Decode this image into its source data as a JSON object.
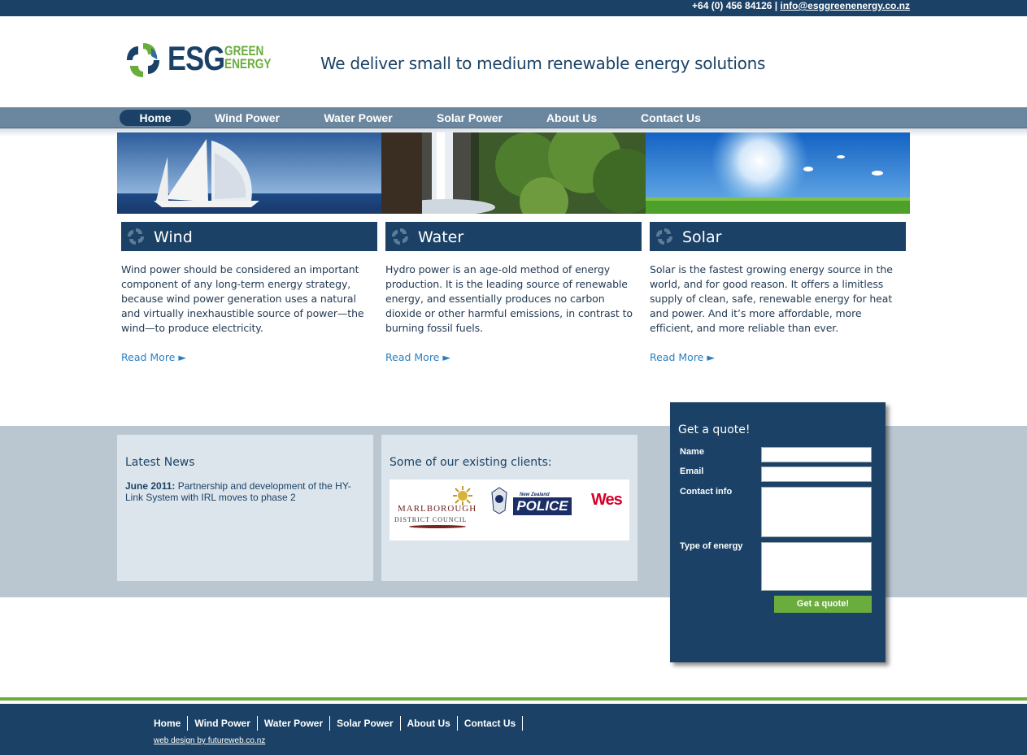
{
  "topbar": {
    "phone": "+64 (0) 456 84126",
    "separator": "|",
    "email": "info@esggreenenergy.co.nz"
  },
  "header": {
    "logo_main": "ESG",
    "logo_sub1": "GREEN",
    "logo_sub2": "ENERGY",
    "tagline": "We deliver small to medium renewable energy solutions"
  },
  "nav": {
    "items": [
      "Home",
      "Wind Power",
      "Water Power",
      "Solar Power",
      "About Us",
      "Contact Us"
    ],
    "active": "Home"
  },
  "columns": [
    {
      "title": "Wind",
      "text": "Wind power should be considered an important component of any long-term energy strategy, because wind power generation uses a natural and virtually inexhaustible source of power—the wind—to produce electricity.",
      "more": "Read More ►"
    },
    {
      "title": "Water",
      "text": "Hydro power is an age-old method of energy production. It is the leading source of renewable energy, and essentially produces no carbon dioxide or other harmful emissions, in contrast to burning fossil fuels.",
      "more": "Read More ►"
    },
    {
      "title": "Solar",
      "text": "Solar is the fastest growing energy source in the world, and for good reason. It offers a limitless supply of clean, safe, renewable energy for heat and power. And it’s more affordable, more efficient, and more reliable than ever.",
      "more": "Read More ►"
    }
  ],
  "news": {
    "title": "Latest News",
    "date": "June 2011:",
    "text": "Partnership and development of the HY-Link System with IRL moves to phase 2"
  },
  "clients": {
    "title": "Some of our existing clients:",
    "logo1_a": "MARLBOROUGH",
    "logo1_b": "DISTRICT COUNCIL",
    "logo2_a": "New Zealand",
    "logo2_b": "POLICE",
    "logo3": "Wes"
  },
  "quote": {
    "title": "Get a quote!",
    "name": "Name",
    "email": "Email",
    "contact": "Contact info",
    "energy": "Type of energy",
    "button": "Get a quote!"
  },
  "footer": {
    "links": [
      "Home",
      "Wind Power",
      "Water Power",
      "Solar Power",
      "About Us",
      "Contact Us"
    ],
    "credit": "web design by futureweb.co.nz"
  },
  "colors": {
    "navy": "#1b4266",
    "green": "#6aad3d",
    "nav": "#6b87a0",
    "link": "#2b7fc0"
  }
}
